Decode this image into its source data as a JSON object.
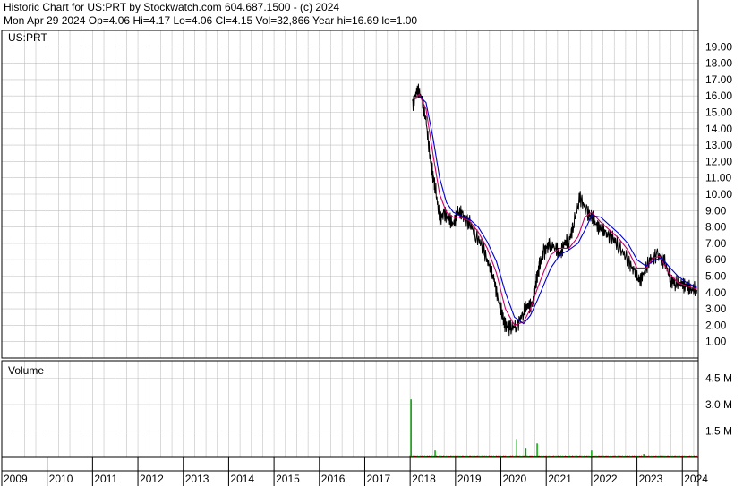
{
  "header": {
    "line1": "Historic Chart for US:PRT by Stockwatch.com 604.687.1500 - (c) 2024",
    "line2": "Mon Apr 29 2024  Op=4.06  Hi=4.17  Lo=4.06  Cl=4.15  Vol=32,866  Year hi=16.69  lo=1.00"
  },
  "chart_data": [
    {
      "type": "line",
      "title": "US:PRT",
      "ylim": [
        0,
        20
      ],
      "yticks": [
        "1.00",
        "2.00",
        "3.00",
        "4.00",
        "5.00",
        "6.00",
        "7.00",
        "8.00",
        "9.00",
        "10.00",
        "11.00",
        "12.00",
        "13.00",
        "14.00",
        "15.00",
        "16.00",
        "17.00",
        "18.00",
        "19.00"
      ],
      "x_range": [
        2009.0,
        2024.35
      ],
      "grid": true,
      "colors": {
        "price": "#000000",
        "ma_short": "#cc0066",
        "ma_long": "#0000cc",
        "grid": "#c0c0c0"
      },
      "series": [
        {
          "name": "",
          "values_x": [
            2018.05,
            2018.15,
            2018.25,
            2018.35,
            2018.45,
            2018.5,
            2018.55,
            2018.65,
            2018.75,
            2018.85,
            2018.95,
            2019.05,
            2019.15,
            2019.3,
            2019.45,
            2019.6,
            2019.75,
            2019.85,
            2019.95,
            2020.05,
            2020.1,
            2020.2,
            2020.35,
            2020.5,
            2020.6,
            2020.7,
            2020.75,
            2020.8,
            2020.85,
            2020.95,
            2021.05,
            2021.2,
            2021.3,
            2021.4,
            2021.5,
            2021.6,
            2021.75,
            2021.9,
            2022.0,
            2022.1,
            2022.2,
            2022.3,
            2022.45,
            2022.6,
            2022.8,
            2022.95,
            2023.05,
            2023.15,
            2023.3,
            2023.45,
            2023.6,
            2023.75,
            2023.85,
            2024.0,
            2024.1,
            2024.2,
            2024.32
          ],
          "values": [
            15.5,
            16.3,
            16.0,
            14.5,
            12.0,
            11.2,
            10.5,
            8.5,
            8.8,
            8.5,
            8.2,
            8.9,
            8.7,
            8.3,
            7.5,
            6.8,
            5.5,
            4.8,
            3.5,
            2.4,
            2.0,
            1.8,
            2.0,
            2.8,
            3.2,
            3.3,
            4.2,
            5.0,
            5.6,
            6.5,
            6.9,
            6.8,
            6.3,
            7.0,
            7.1,
            8.2,
            9.8,
            8.9,
            8.6,
            8.2,
            7.9,
            7.6,
            7.4,
            6.8,
            6.0,
            5.2,
            4.7,
            5.2,
            6.0,
            6.3,
            5.9,
            4.8,
            4.6,
            4.5,
            4.4,
            4.2,
            4.15
          ]
        },
        {
          "name": "",
          "values_x": [
            2018.1,
            2018.2,
            2018.35,
            2018.5,
            2018.65,
            2018.8,
            2018.95,
            2019.1,
            2019.3,
            2019.5,
            2019.7,
            2019.9,
            2020.1,
            2020.3,
            2020.5,
            2020.65,
            2020.8,
            2020.95,
            2021.1,
            2021.3,
            2021.5,
            2021.7,
            2021.85,
            2022.0,
            2022.2,
            2022.4,
            2022.6,
            2022.8,
            2023.0,
            2023.2,
            2023.35,
            2023.5,
            2023.7,
            2023.9,
            2024.1,
            2024.32
          ],
          "values": [
            15.8,
            16.1,
            15.2,
            12.5,
            10.0,
            8.9,
            8.6,
            8.6,
            8.4,
            7.7,
            6.7,
            5.2,
            3.0,
            2.0,
            2.2,
            3.0,
            4.2,
            5.3,
            6.3,
            6.7,
            6.7,
            7.4,
            8.6,
            8.9,
            8.3,
            7.8,
            7.3,
            6.6,
            5.5,
            5.5,
            6.1,
            6.2,
            5.2,
            4.6,
            4.4,
            4.2
          ]
        },
        {
          "name": "",
          "values_x": [
            2018.2,
            2018.35,
            2018.5,
            2018.65,
            2018.8,
            2018.95,
            2019.1,
            2019.3,
            2019.5,
            2019.7,
            2019.9,
            2020.1,
            2020.3,
            2020.5,
            2020.65,
            2020.8,
            2020.95,
            2021.1,
            2021.3,
            2021.5,
            2021.7,
            2021.85,
            2022.0,
            2022.2,
            2022.4,
            2022.6,
            2022.8,
            2023.0,
            2023.2,
            2023.4,
            2023.55,
            2023.7,
            2023.9,
            2024.1,
            2024.32
          ],
          "values": [
            16.0,
            15.6,
            13.5,
            11.0,
            9.5,
            8.9,
            8.7,
            8.5,
            8.0,
            7.1,
            5.9,
            4.0,
            2.5,
            2.1,
            2.6,
            3.5,
            4.5,
            5.5,
            6.3,
            6.6,
            7.0,
            7.8,
            8.7,
            8.6,
            8.1,
            7.6,
            7.0,
            6.0,
            5.6,
            6.0,
            6.1,
            5.6,
            5.0,
            4.6,
            4.3
          ]
        }
      ]
    },
    {
      "type": "bar",
      "title": "Volume",
      "yticks": [
        "1.5 M",
        "3.0 M",
        "4.5 M"
      ],
      "ylim": [
        0,
        5.5
      ],
      "unit": "M",
      "spikes_x": [
        2018.02,
        2018.55,
        2020.35,
        2020.55,
        2020.8,
        2022.0,
        2023.15
      ],
      "spikes": [
        3.3,
        0.4,
        1.0,
        0.5,
        0.8,
        0.4,
        0.2
      ],
      "baseline": 0.12,
      "colors": {
        "up": "#00aa00",
        "down": "#cc0000"
      }
    }
  ],
  "x_axis": {
    "labels": [
      "2009",
      "2010",
      "2011",
      "2012",
      "2013",
      "2014",
      "2015",
      "2016",
      "2017",
      "2018",
      "2019",
      "2020",
      "2021",
      "2022",
      "2023",
      "2024"
    ]
  }
}
